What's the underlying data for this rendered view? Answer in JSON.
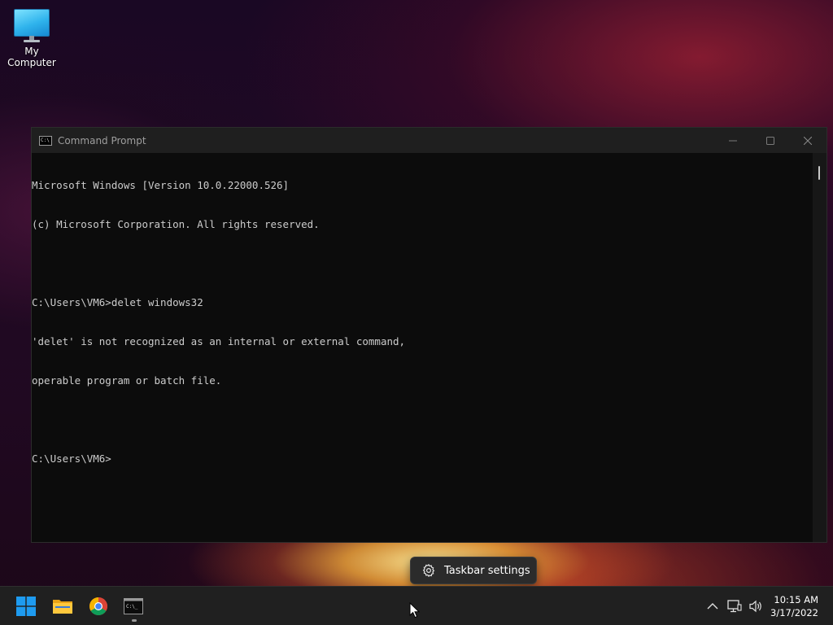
{
  "desktop": {
    "icons": [
      {
        "label": "My Computer",
        "icon": "monitor-icon"
      }
    ]
  },
  "window": {
    "title": "Command Prompt",
    "controls": [
      "minimize-icon",
      "maximize-icon",
      "close-icon"
    ],
    "lines": [
      "Microsoft Windows [Version 10.0.22000.526]",
      "(c) Microsoft Corporation. All rights reserved.",
      "",
      "C:\\Users\\VM6>delet windows32",
      "'delet' is not recognized as an internal or external command,",
      "operable program or batch file.",
      "",
      "C:\\Users\\VM6>"
    ]
  },
  "context_menu": {
    "item_label": "Taskbar settings",
    "icon": "gear-icon"
  },
  "taskbar": {
    "pinned": [
      {
        "name": "start-button",
        "icon": "windows-logo-icon"
      },
      {
        "name": "file-explorer-button",
        "icon": "folder-icon"
      },
      {
        "name": "chrome-button",
        "icon": "chrome-icon"
      },
      {
        "name": "command-prompt-button",
        "icon": "terminal-icon",
        "running": true
      }
    ],
    "tray_icons": [
      "chevron-up-icon",
      "network-icon",
      "volume-icon"
    ],
    "time": "10:15 AM",
    "date": "3/17/2022"
  },
  "colors": {
    "terminal_bg": "#0c0c0c",
    "terminal_fg": "#cccccc",
    "titlebar_bg": "#1f1f1f",
    "taskbar_bg": "#202020",
    "windows_blue": "#1e9bf0"
  }
}
